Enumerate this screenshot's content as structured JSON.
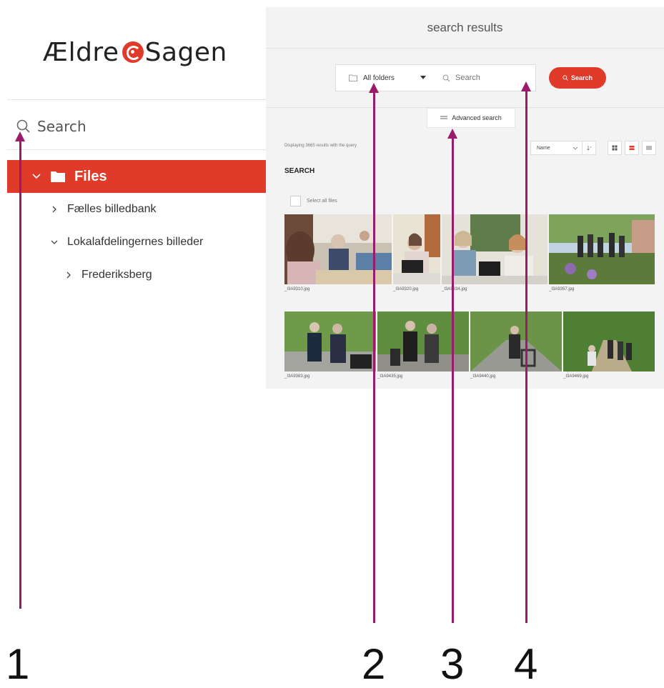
{
  "sidebar": {
    "logo_left": "Ældre",
    "logo_right": "Sagen",
    "search_placeholder": "Search",
    "root_label": "Files",
    "items": [
      {
        "label": "Fælles billedbank"
      },
      {
        "label": "Lokalafdelingernes billeder"
      },
      {
        "label": "Frederiksberg"
      }
    ]
  },
  "main": {
    "title": "search results",
    "folder_select": "All folders",
    "search_placeholder": "Search",
    "search_button": "Search",
    "advanced_search": "Advanced search",
    "displaying": "Displaying 3665 results with the query",
    "sort_value": "Name",
    "section_title": "SEARCH",
    "select_all": "Select all files",
    "thumbnails": [
      {
        "file": "_I3A9310.jpg"
      },
      {
        "file": "_I3A9320.jpg"
      },
      {
        "file": "_I3A9334.jpg"
      },
      {
        "file": "_I3A9357.jpg"
      },
      {
        "file": "_I3A9383.jpg"
      },
      {
        "file": "_I3A9435.jpg"
      },
      {
        "file": "_I3A9440.jpg"
      },
      {
        "file": "_I3A9469.jpg"
      }
    ]
  },
  "callouts": [
    "1",
    "2",
    "3",
    "4"
  ],
  "colors": {
    "brand_red": "#e03a2b",
    "callout": "#9b1b6b"
  }
}
